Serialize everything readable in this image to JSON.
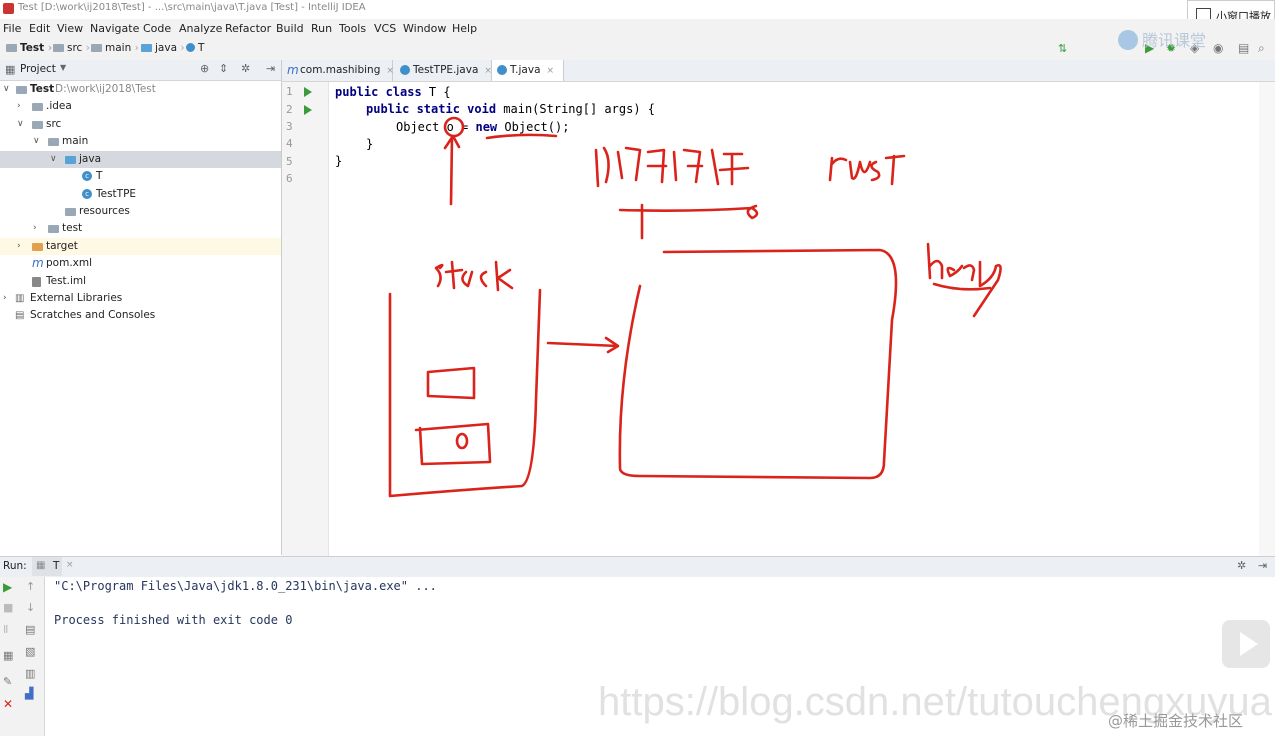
{
  "window": {
    "title": "Test [D:\\work\\ij2018\\Test] - ...\\src\\main\\java\\T.java [Test] - IntelliJ IDEA",
    "mini_label": "小窗口播放",
    "overlay_brand": "腾讯课堂"
  },
  "menu": [
    "File",
    "Edit",
    "View",
    "Navigate",
    "Code",
    "Analyze",
    "Refactor",
    "Build",
    "Run",
    "Tools",
    "VCS",
    "Window",
    "Help"
  ],
  "breadcrumb": [
    "Test",
    "src",
    "main",
    "java",
    "T"
  ],
  "run_config": "T",
  "project_panel": {
    "title": "Project"
  },
  "tree": [
    {
      "label": "Test",
      "path": "D:\\work\\ij2018\\Test"
    },
    {
      "label": ".idea"
    },
    {
      "label": "src"
    },
    {
      "label": "main"
    },
    {
      "label": "java"
    },
    {
      "label": "T"
    },
    {
      "label": "TestTPE"
    },
    {
      "label": "resources"
    },
    {
      "label": "test"
    },
    {
      "label": "target"
    },
    {
      "label": "pom.xml"
    },
    {
      "label": "Test.iml"
    },
    {
      "label": "External Libraries"
    },
    {
      "label": "Scratches and Consoles"
    }
  ],
  "tabs": [
    {
      "label": "com.mashibing"
    },
    {
      "label": "TestTPE.java"
    },
    {
      "label": "T.java"
    }
  ],
  "editor": {
    "line_numbers": [
      "1",
      "2",
      "3",
      "4",
      "5",
      "6"
    ],
    "lines": [
      {
        "kw": "public class",
        "rest": " T {"
      },
      {
        "kw": "public static void",
        "rest": " main(String[] args) {"
      },
      {
        "text": "Object o = ",
        "kw": "new",
        "rest": " Object();"
      },
      {
        "text": "}"
      },
      {
        "text": "}"
      },
      {
        "text": ""
      }
    ]
  },
  "annotations": {
    "label_stack": "stack",
    "label_heap": "heap",
    "label_rust": "rust",
    "label_cn": "所有程序",
    "box_var": "o"
  },
  "run_panel": {
    "title": "Run:",
    "tab": "T",
    "console": [
      "\"C:\\Program Files\\Java\\jdk1.8.0_231\\bin\\java.exe\" ...",
      "Process finished with exit code 0"
    ]
  },
  "watermark": {
    "url": "https://blog.csdn.net/tutouchengxuyua",
    "community": "@稀土掘金技术社区"
  },
  "colors": {
    "ink": "#d9231b",
    "keyword": "#000080",
    "run_green": "#3b9b3b"
  }
}
